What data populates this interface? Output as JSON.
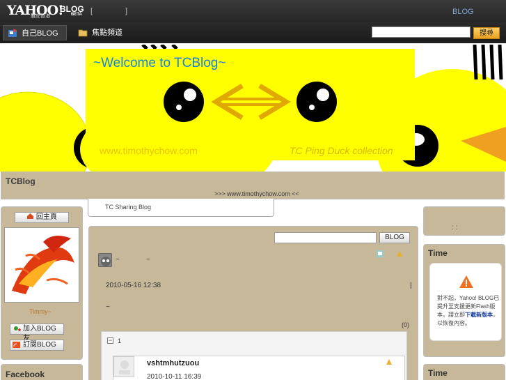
{
  "topbar": {
    "logo_text": "YAHOO!",
    "logo_sub": "雅虎香港",
    "logo_blog": "BLOG",
    "logo_beta": "BETA",
    "bracket_open": "[",
    "bracket_close": "]",
    "link_blog": "BLOG"
  },
  "nav": {
    "my_blog": "自己BLOG",
    "focus_channel": "焦點頻道",
    "search_button": "搜尋",
    "search_placeholder": ""
  },
  "banner": {
    "welcome": "~Welcome to TCBlog~",
    "url": "www.timothychow.com",
    "collection": "TC Ping Duck collection"
  },
  "blog": {
    "title": "TCBlog",
    "url_line": ">>> www.timothychow.com <<",
    "tab_label": "TC Sharing Blog"
  },
  "left": {
    "home_button": "回主頁",
    "user_name": "Timmy~",
    "add_friend": "加入BLOG 友",
    "subscribe": "訂閱BLOG",
    "facebook_heading": "Facebook"
  },
  "main": {
    "search_placeholder": "",
    "search_button": "BLOG",
    "post_tilde1": "~",
    "post_tilde2": "~",
    "post_date": "2010-05-16 12:38",
    "post_bar": "|",
    "post_tilde3": "~",
    "comment_count": "(0)",
    "comments_toggle": "−",
    "comments_num": "1",
    "commenter_name": "vshtmhutzuou",
    "comment_date": "2010-10-11 16:39"
  },
  "right": {
    "box1_text": ":   :",
    "time_heading": "Time",
    "flash_msg_1": "對不起，Yahoo! BLOG已提升至支援更新Flash版本，請立即",
    "flash_link": "下載新版本",
    "flash_msg_2": "，以恢復內容。",
    "time_heading_2": "Time"
  },
  "colors": {
    "panel": "#c8b89a",
    "banner_yellow": "#ffff00",
    "welcome_blue": "#1a82d8",
    "search_orange": "#e6a020"
  }
}
